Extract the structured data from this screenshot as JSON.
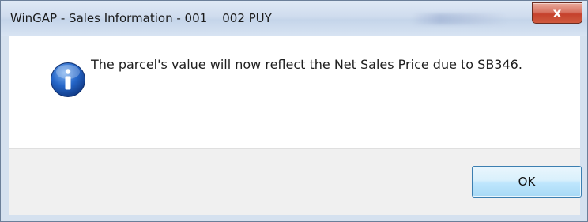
{
  "dialog": {
    "title": "WinGAP - Sales Information - 001    002 PUY",
    "close_label": "x",
    "icon": "information-icon",
    "message": "The parcel's value will now reflect the Net Sales Price due to SB346.",
    "ok_label": "OK"
  },
  "colors": {
    "titlebar": "#cfdcee",
    "close_button": "#c5412c",
    "content_bg": "#ffffff",
    "footer_bg": "#f0f0f0",
    "ok_border": "#3c7fb1",
    "info_icon": "#1f5fbf"
  }
}
